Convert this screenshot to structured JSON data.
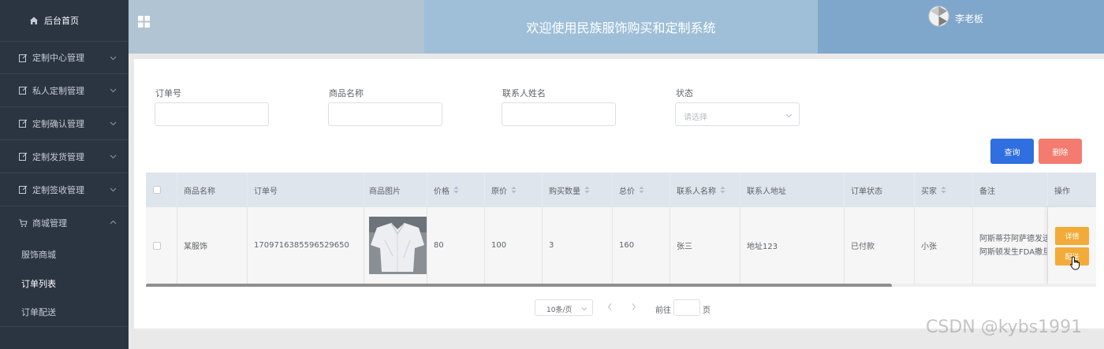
{
  "sidebar": {
    "home": "后台首页",
    "items": [
      {
        "label": "定制中心管理"
      },
      {
        "label": "私人定制管理"
      },
      {
        "label": "定制确认管理"
      },
      {
        "label": "定制发货管理"
      },
      {
        "label": "定制签收管理"
      },
      {
        "label": "商城管理"
      }
    ],
    "sub_items": [
      {
        "label": "服饰商城"
      },
      {
        "label": "订单列表"
      },
      {
        "label": "订单配送"
      }
    ]
  },
  "header": {
    "title": "欢迎使用民族服饰购买和定制系统",
    "user": "李老板"
  },
  "filters": {
    "order_no_label": "订单号",
    "product_name_label": "商品名称",
    "contact_name_label": "联系人姓名",
    "status_label": "状态",
    "status_placeholder": "请选择"
  },
  "buttons": {
    "query": "查询",
    "delete": "删除"
  },
  "table": {
    "headers": {
      "product_name": "商品名称",
      "order_no": "订单号",
      "product_image": "商品图片",
      "price": "价格",
      "original_price": "原价",
      "quantity": "购买数量",
      "total": "总价",
      "contact_name": "联系人名称",
      "contact_address": "联系人地址",
      "order_status": "订单状态",
      "buyer": "买家",
      "note": "备注",
      "actions": "操作"
    },
    "rows": [
      {
        "product_name": "某服饰",
        "order_no": "1709716385596529650",
        "price": "80",
        "original_price": "100",
        "quantity": "3",
        "total": "160",
        "contact_name": "张三",
        "contact_address": "地址123",
        "order_status": "已付款",
        "buyer": "小张",
        "note_line1": "阿斯蒂芬阿萨德发送",
        "note_line2": "阿斯顿发生FDA撒旦",
        "btn_detail": "详情",
        "btn_ship": "配送"
      }
    ]
  },
  "pagination": {
    "page_size": "10条/页",
    "goto_prefix": "前往",
    "goto_suffix": "页"
  },
  "watermark": "CSDN @kybs1991",
  "colors": {
    "sidebar_bg": "#2b3542",
    "primary": "#2f6fe0",
    "danger": "#f47b6f",
    "warning": "#f2ab38"
  }
}
